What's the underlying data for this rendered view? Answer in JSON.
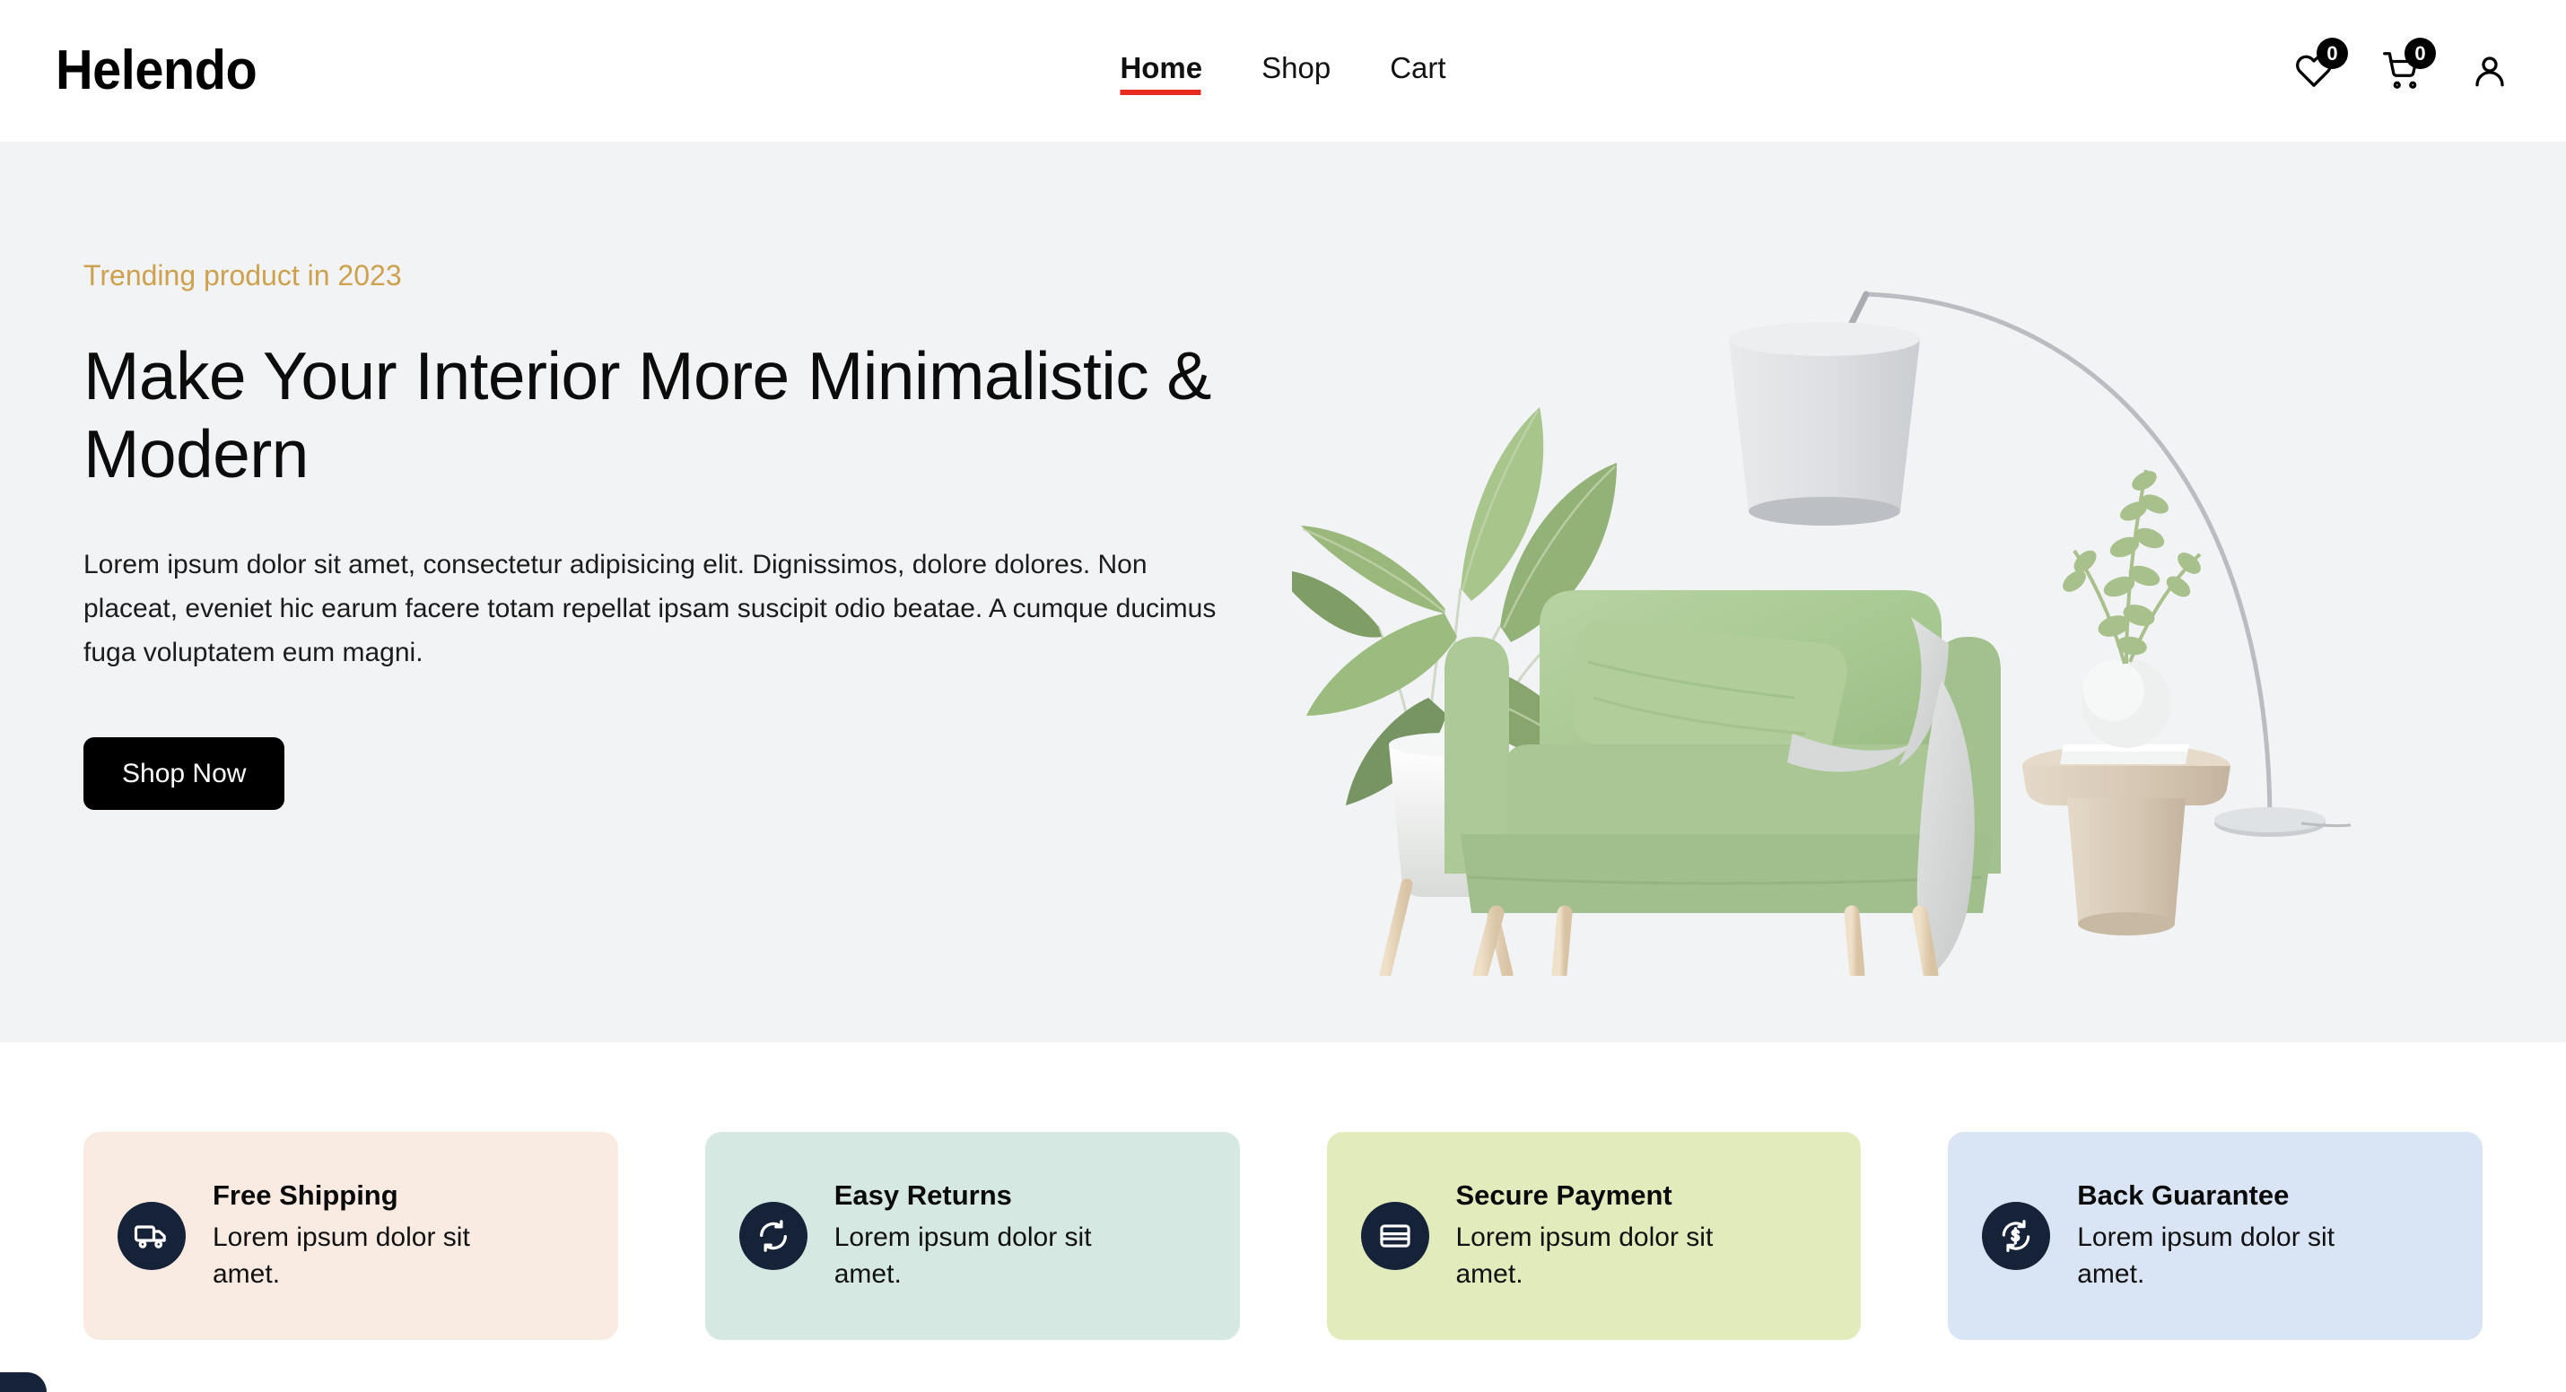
{
  "brand": {
    "name": "Helendo"
  },
  "nav": {
    "items": [
      {
        "label": "Home",
        "active": true
      },
      {
        "label": "Shop",
        "active": false
      },
      {
        "label": "Cart",
        "active": false
      }
    ]
  },
  "header_actions": {
    "wishlist": {
      "icon": "heart-icon",
      "count": "0"
    },
    "cart": {
      "icon": "shopping-cart-icon",
      "count": "0"
    },
    "account": {
      "icon": "user-icon"
    }
  },
  "hero": {
    "eyebrow": "Trending product in 2023",
    "title": "Make Your Interior More Minimalistic & Modern",
    "description": "Lorem ipsum dolor sit amet, consectetur adipisicing elit. Dignissimos, dolore dolores. Non placeat, eveniet hic earum facere totam repellat ipsam suscipit odio beatae. A cumque ducimus fuga voluptatem eum magni.",
    "cta_label": "Shop Now",
    "image_alt": "Green armchair with houseplant, side table and arc floor lamp",
    "bg_color": "#f2f3f5",
    "eyebrow_color": "#cda14e",
    "cta_bg": "#000000"
  },
  "features": {
    "cards": [
      {
        "title": "Free Shipping",
        "description": "Lorem ipsum dolor sit amet.",
        "icon": "truck-icon",
        "bg_color": "#faebe2",
        "icon_bg": "#152238"
      },
      {
        "title": "Easy Returns",
        "description": "Lorem ipsum dolor sit amet.",
        "icon": "refresh-icon",
        "bg_color": "#d6e8e2",
        "icon_bg": "#152238"
      },
      {
        "title": "Secure Payment",
        "description": "Lorem ipsum dolor sit amet.",
        "icon": "credit-card-icon",
        "bg_color": "#e2ebbc",
        "icon_bg": "#152238"
      },
      {
        "title": "Back Guarantee",
        "description": "Lorem ipsum dolor sit amet.",
        "icon": "money-back-icon",
        "bg_color": "#d9e4f5",
        "icon_bg": "#152238"
      }
    ]
  },
  "theme": {
    "accent_red": "#e8291d",
    "navy": "#152238",
    "gold": "#cda14e"
  }
}
